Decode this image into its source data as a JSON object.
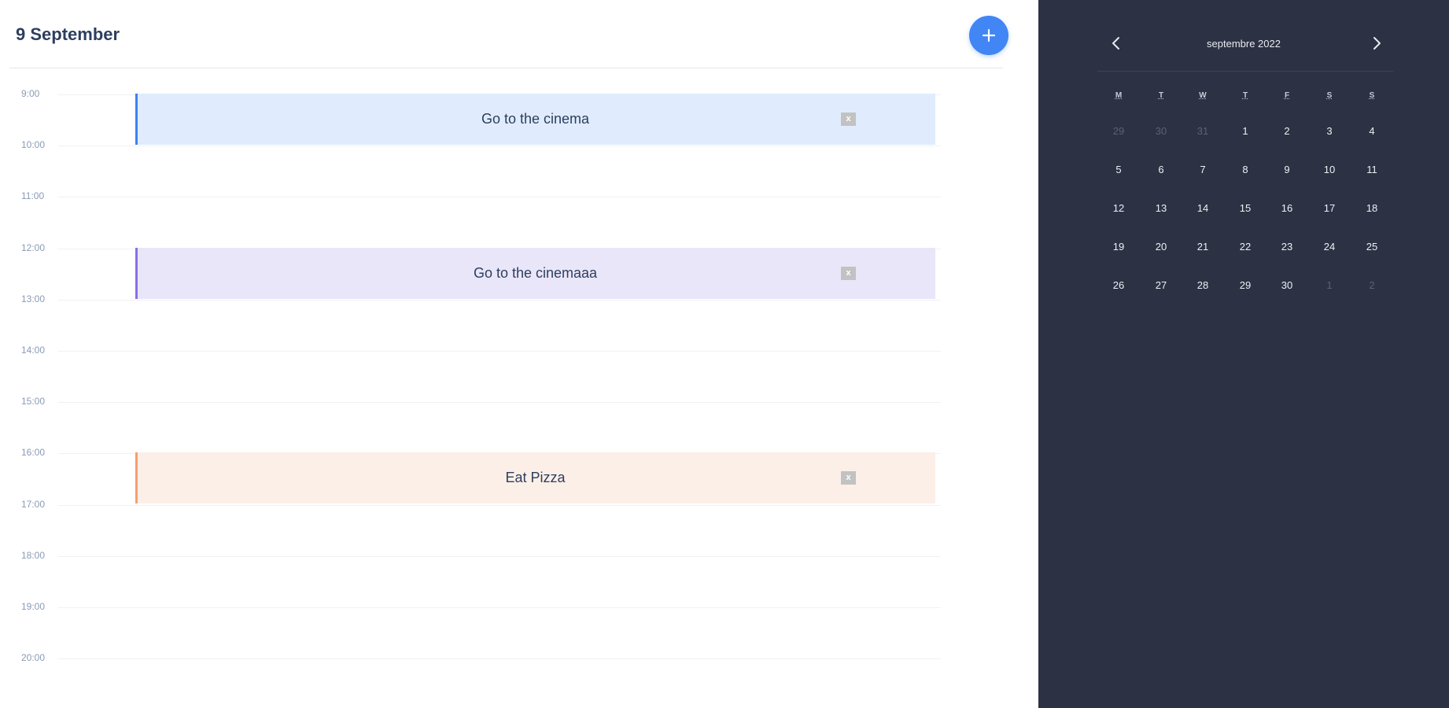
{
  "day_view": {
    "title": "9 September",
    "add_button_icon": "plus-icon",
    "hours": [
      "9:00",
      "10:00",
      "11:00",
      "12:00",
      "13:00",
      "14:00",
      "15:00",
      "16:00",
      "17:00",
      "18:00",
      "19:00",
      "20:00"
    ],
    "events": [
      {
        "title": "Go to the cinema",
        "start": "9:00",
        "end": "10:00",
        "accent_color": "#3b82f6",
        "bg_color": "#e0ecfd",
        "delete_label": "x"
      },
      {
        "title": "Go to the cinemaaa",
        "start": "12:00",
        "end": "13:00",
        "accent_color": "#8b6ee6",
        "bg_color": "#eae6f9",
        "delete_label": "x"
      },
      {
        "title": "Eat Pizza",
        "start": "16:00",
        "end": "17:00",
        "accent_color": "#f5a071",
        "bg_color": "#fcefe8",
        "delete_label": "x"
      }
    ]
  },
  "calendar": {
    "month_label": "septembre 2022",
    "prev_icon": "chevron-left-icon",
    "next_icon": "chevron-right-icon",
    "weekdays": [
      "M",
      "T",
      "W",
      "T",
      "F",
      "S",
      "S"
    ],
    "weeks": [
      [
        {
          "d": "29",
          "muted": true
        },
        {
          "d": "30",
          "muted": true
        },
        {
          "d": "31",
          "muted": true
        },
        {
          "d": "1"
        },
        {
          "d": "2"
        },
        {
          "d": "3"
        },
        {
          "d": "4"
        }
      ],
      [
        {
          "d": "5"
        },
        {
          "d": "6"
        },
        {
          "d": "7"
        },
        {
          "d": "8"
        },
        {
          "d": "9"
        },
        {
          "d": "10"
        },
        {
          "d": "11"
        }
      ],
      [
        {
          "d": "12"
        },
        {
          "d": "13"
        },
        {
          "d": "14"
        },
        {
          "d": "15"
        },
        {
          "d": "16"
        },
        {
          "d": "17"
        },
        {
          "d": "18"
        }
      ],
      [
        {
          "d": "19"
        },
        {
          "d": "20"
        },
        {
          "d": "21"
        },
        {
          "d": "22"
        },
        {
          "d": "23"
        },
        {
          "d": "24"
        },
        {
          "d": "25"
        }
      ],
      [
        {
          "d": "26"
        },
        {
          "d": "27"
        },
        {
          "d": "28"
        },
        {
          "d": "29"
        },
        {
          "d": "30"
        },
        {
          "d": "1",
          "muted": true
        },
        {
          "d": "2",
          "muted": true
        }
      ]
    ]
  },
  "colors": {
    "accent": "#4285f4",
    "sidebar_bg": "#2c3143"
  }
}
